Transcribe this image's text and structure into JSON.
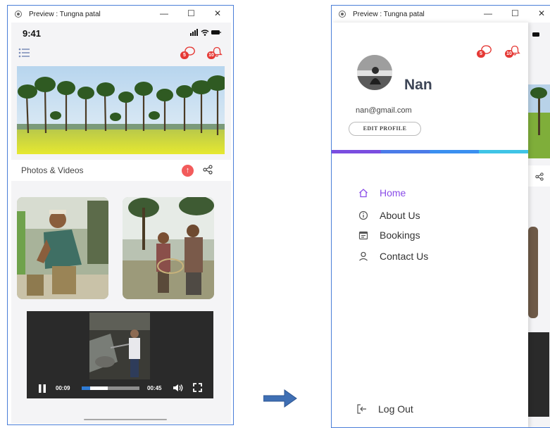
{
  "window_title": "Preview : Tungna patal",
  "status": {
    "time": "9:41"
  },
  "badges": {
    "chat": "5",
    "notifications": "10"
  },
  "section": {
    "title": "Photos & Videos"
  },
  "video": {
    "elapsed": "00:09",
    "duration": "00:45",
    "progress": 0.45
  },
  "drawer": {
    "name": "Nan",
    "email": "nan@gmail.com",
    "edit_label": "EDIT PROFILE",
    "items": [
      {
        "label": "Home",
        "icon": "home-icon",
        "active": true
      },
      {
        "label": "About Us",
        "icon": "info-icon",
        "active": false
      },
      {
        "label": "Bookings",
        "icon": "calendar-icon",
        "active": false
      },
      {
        "label": "Contact Us",
        "icon": "person-icon",
        "active": false
      }
    ],
    "logout_label": "Log Out"
  },
  "colors": {
    "accent": "#8a4de8",
    "badge": "#e53935",
    "window_border": "#4a7ed8",
    "arrow": "#3f6fb4"
  }
}
